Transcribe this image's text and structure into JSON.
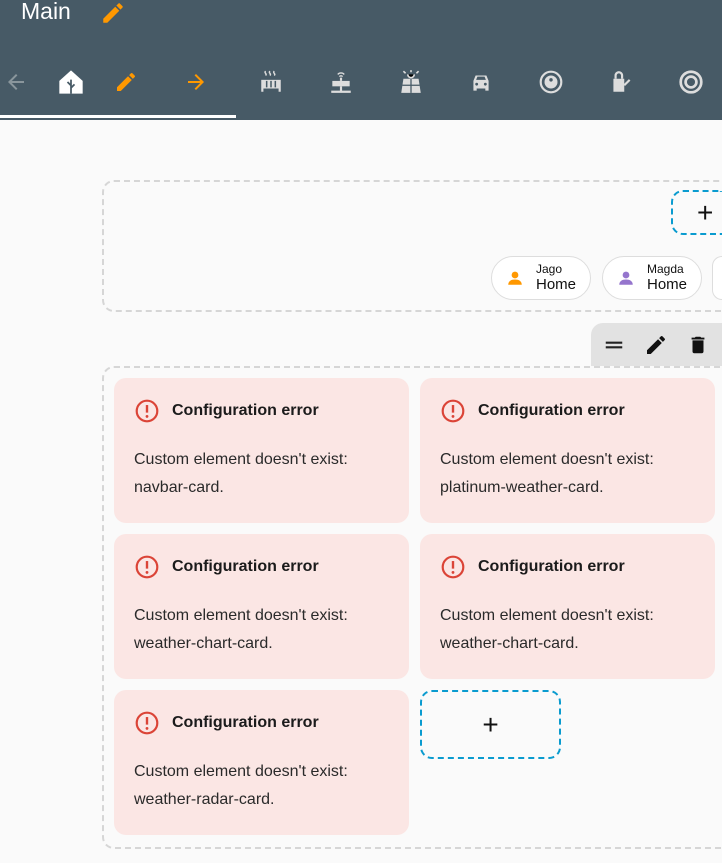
{
  "header": {
    "title": "Main"
  },
  "tabs": [
    "back",
    "home",
    "edit",
    "forward",
    "radiator",
    "router",
    "solar-panel",
    "car",
    "robot-vacuum",
    "watering-can",
    "washing-machine"
  ],
  "badges": [
    {
      "name": "Jago",
      "state": "Home",
      "color": "#ff9800"
    },
    {
      "name": "Magda",
      "state": "Home",
      "color": "#9575cd"
    }
  ],
  "add_label": "+",
  "errors": [
    {
      "title": "Configuration error",
      "message": "Custom element doesn't exist: navbar-card."
    },
    {
      "title": "Configuration error",
      "message": "Custom element doesn't exist: platinum-weather-card."
    },
    {
      "title": "Configuration error",
      "message": "Custom element doesn't exist: weather-chart-card."
    },
    {
      "title": "Configuration error",
      "message": "Custom element doesn't exist: weather-chart-card."
    },
    {
      "title": "Configuration error",
      "message": "Custom element doesn't exist: weather-radar-card."
    }
  ],
  "colors": {
    "header": "#475a66",
    "accent": "#ff9800",
    "error": "#db4437",
    "dash": "#0a9bcf"
  }
}
